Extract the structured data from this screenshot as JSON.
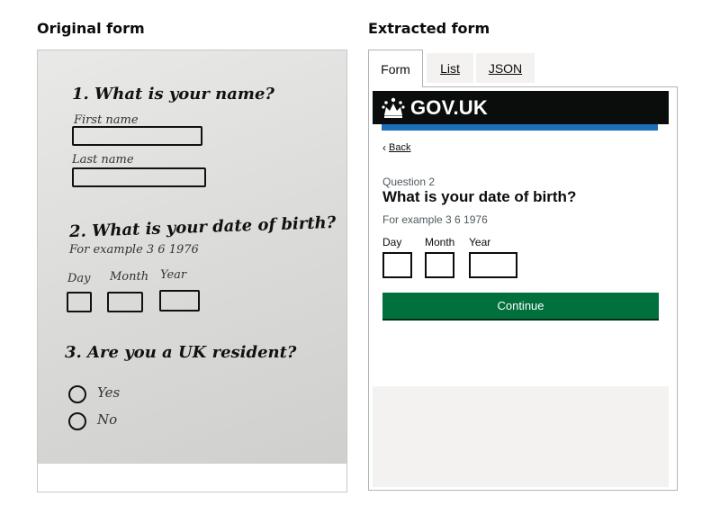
{
  "left_panel": {
    "title": "Original form",
    "paper": {
      "q1": "1. What is your name?",
      "first_name": "First name",
      "last_name": "Last name",
      "q2": "2. What is your date of birth?",
      "example": "For example 3 6 1976",
      "day": "Day",
      "month": "Month",
      "year": "Year",
      "q3": "3. Are you a UK resident?",
      "yes": "Yes",
      "no": "No"
    }
  },
  "right_panel": {
    "title": "Extracted form",
    "tabs": [
      {
        "label": "Form",
        "active": true
      },
      {
        "label": "List",
        "active": false
      },
      {
        "label": "JSON",
        "active": false
      }
    ],
    "preview": {
      "logo_text": "GOV.UK",
      "back_link": "Back",
      "caption": "Question 2",
      "question": "What is your date of birth?",
      "hint": "For example 3 6 1976",
      "fields": {
        "day": "Day",
        "month": "Month",
        "year": "Year"
      },
      "continue_label": "Continue"
    }
  },
  "colors": {
    "header_black": "#0b0c0c",
    "govuk_blue": "#1d70b8",
    "button_green": "#00703c",
    "footer_grey": "#f3f2f1"
  },
  "icons": [
    "crown-icon",
    "chevron-left-icon"
  ]
}
